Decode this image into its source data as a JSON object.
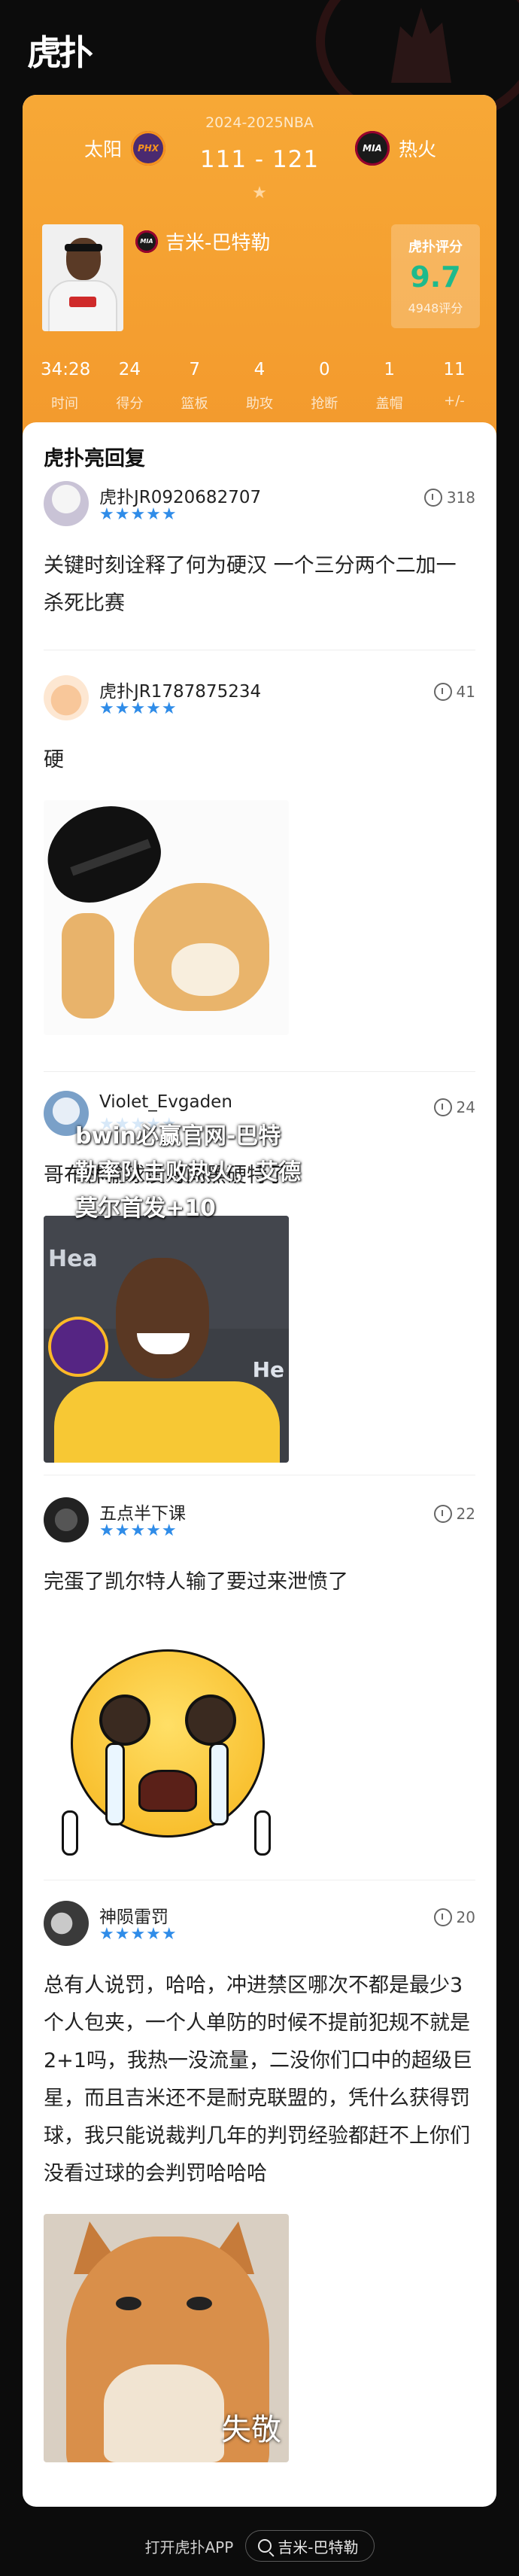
{
  "app": {
    "logo_text": "虎扑"
  },
  "game": {
    "season": "2024-2025NBA",
    "home_team": {
      "name": "太阳",
      "logo_text": "PHX"
    },
    "away_team": {
      "name": "热火",
      "logo_text": "MIA"
    },
    "score": "111 - 121",
    "star_icon": "★"
  },
  "player": {
    "name": "吉米-巴特勒",
    "team_logo_text": "MIA",
    "rating_title": "虎扑评分",
    "rating_score": "9.7",
    "rating_count": "4948评分",
    "stats": [
      {
        "value": "34:28",
        "label": "时间"
      },
      {
        "value": "24",
        "label": "得分"
      },
      {
        "value": "7",
        "label": "篮板"
      },
      {
        "value": "4",
        "label": "助攻"
      },
      {
        "value": "0",
        "label": "抢断"
      },
      {
        "value": "1",
        "label": "盖帽"
      },
      {
        "value": "11",
        "label": "+/-"
      }
    ]
  },
  "section_title": "虎扑亮回复",
  "replies": [
    {
      "user": "虎扑JR0920682707",
      "stars": "★★★★★",
      "likes": "318",
      "text": "关键时刻诠释了何为硬汉 一个三分两个二加一杀死比赛"
    },
    {
      "user": "虎扑JR1787875234",
      "stars": "★★★★★",
      "likes": "41",
      "text": "硬"
    },
    {
      "user": "Violet_Evgaden",
      "stars": "★★★★★",
      "likes": "24",
      "text": "哥布林输球没时间黑硬特了"
    },
    {
      "user": "五点半下课",
      "stars": "★★★★★",
      "likes": "22",
      "text": "完蛋了凯尔特人输了要过来泄愤了"
    },
    {
      "user": "神陨雷罚",
      "stars": "★★★★★",
      "likes": "20",
      "text": "总有人说罚，哈哈，冲进禁区哪次不都是最少3个人包夹，一个人单防的时候不提前犯规不就是2+1吗，我热一没流量，二没你们口中的超级巨星，而且吉米还不是耐克联盟的，凭什么获得罚球，我只能说裁判几年的判罚经验都赶不上你们没看过球的会判罚哈哈哈"
    }
  ],
  "overlay_text": "bwin必赢官网-巴特勒率队击败热火，艾德莫尔首发+10",
  "image_captions": {
    "cat": "失敬",
    "lebron_left": "Hea",
    "lebron_right": "He"
  },
  "bottom": {
    "open_app": "打开虎扑APP",
    "search_text": "吉米-巴特勒"
  },
  "colors": {
    "header_orange": "#f39a2d",
    "rating_green": "#1eba8c",
    "star_blue": "#2f8ce8"
  }
}
